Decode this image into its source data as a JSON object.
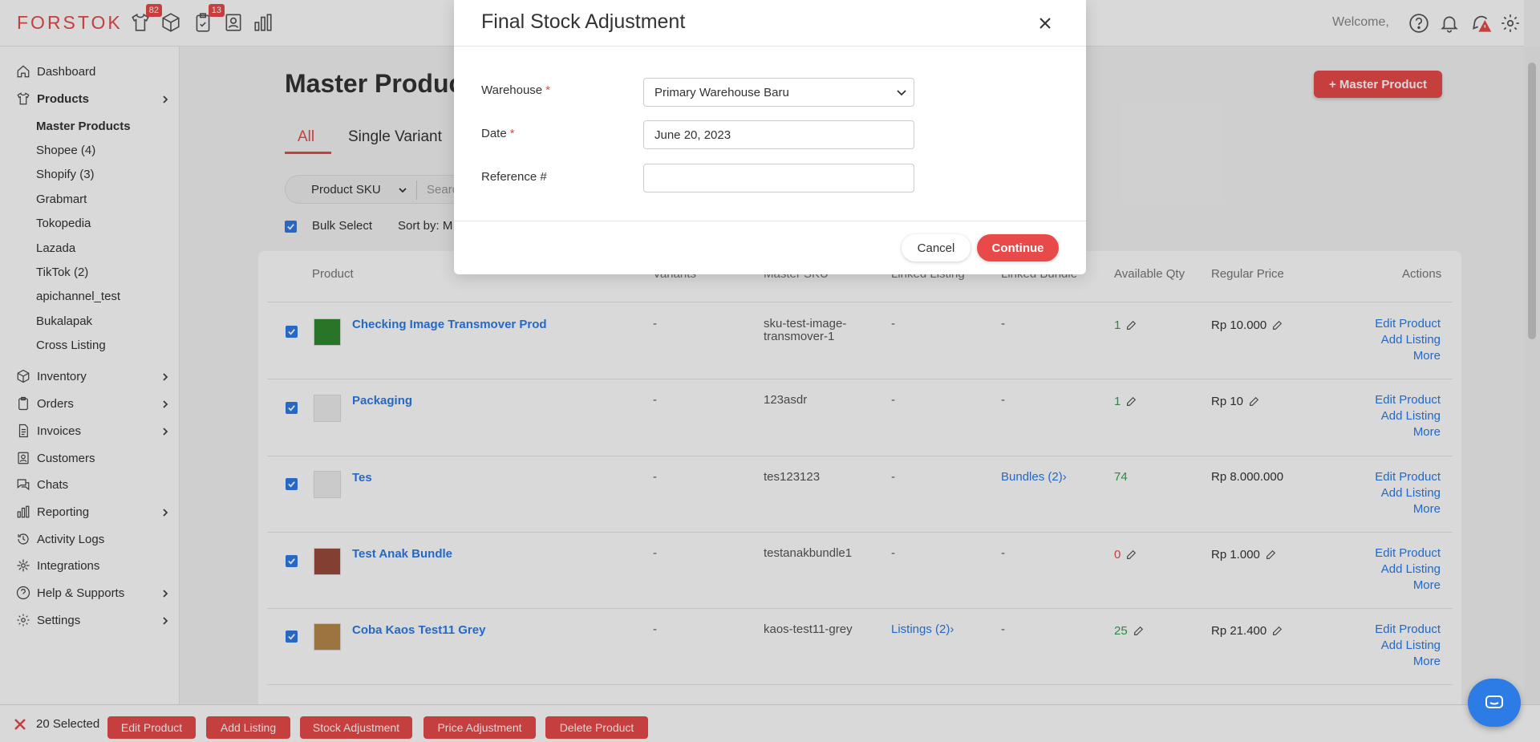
{
  "app": {
    "logo": "FORSTOK",
    "welcome": "Welcome,",
    "badges": {
      "products": "82",
      "orders": "13"
    }
  },
  "sidebar": {
    "items": [
      {
        "label": "Dashboard",
        "icon": "home-icon"
      },
      {
        "label": "Products",
        "icon": "shirt-icon"
      },
      {
        "label": "Inventory",
        "icon": "box-icon"
      },
      {
        "label": "Orders",
        "icon": "clipboard-icon"
      },
      {
        "label": "Invoices",
        "icon": "invoice-icon"
      },
      {
        "label": "Customers",
        "icon": "customers-icon"
      },
      {
        "label": "Chats",
        "icon": "chat-icon"
      },
      {
        "label": "Reporting",
        "icon": "chart-icon"
      },
      {
        "label": "Activity Logs",
        "icon": "history-icon"
      },
      {
        "label": "Integrations",
        "icon": "integrations-icon"
      },
      {
        "label": "Help & Supports",
        "icon": "help-icon"
      },
      {
        "label": "Settings",
        "icon": "gear-icon"
      }
    ],
    "sub_items": [
      "Master Products",
      "Shopee (4)",
      "Shopify (3)",
      "Grabmart",
      "Tokopedia",
      "Lazada",
      "TikTok (2)",
      "apichannel_test",
      "Bukalapak",
      "Cross Listing"
    ]
  },
  "main": {
    "title": "Master Product",
    "add_button": "+ Master Product",
    "tabs": [
      "All",
      "Single Variant"
    ],
    "filter": {
      "select": "Product SKU",
      "search_placeholder": "Searc"
    },
    "bulk_select": "Bulk Select",
    "sort_by": "Sort by:  M",
    "columns": [
      "Product",
      "Variants",
      "Master SKU",
      "Linked Listing",
      "Linked Bundle",
      "Available Qty",
      "Regular Price",
      "Actions"
    ],
    "rows": [
      {
        "name": "Checking Image Transmover Prod",
        "variants": "-",
        "sku": "sku-test-image-transmover-1",
        "listing": "-",
        "bundle": "-",
        "qty": "1",
        "price": "Rp 10.000"
      },
      {
        "name": "Packaging",
        "variants": "-",
        "sku": "123asdr",
        "listing": "-",
        "bundle": "-",
        "qty": "1",
        "price": "Rp 10"
      },
      {
        "name": "Tes",
        "variants": "-",
        "sku": "tes123123",
        "listing": "-",
        "bundle": "Bundles (2)",
        "qty": "74",
        "price": "Rp 8.000.000"
      },
      {
        "name": "Test Anak Bundle",
        "variants": "-",
        "sku": "testanakbundle1",
        "listing": "-",
        "bundle": "-",
        "qty": "0",
        "price": "Rp 1.000"
      },
      {
        "name": "Coba Kaos Test11 Grey",
        "variants": "-",
        "sku": "kaos-test11-grey",
        "listing": "Listings (2)",
        "bundle": "-",
        "qty": "25",
        "price": "Rp 21.400"
      }
    ],
    "actions": [
      "Edit Product",
      "Add Listing",
      "More"
    ]
  },
  "bottom_bar": {
    "selected": "20 Selected",
    "buttons": [
      "Edit Product",
      "Add Listing",
      "Stock Adjustment",
      "Price Adjustment",
      "Delete Product"
    ]
  },
  "modal": {
    "title": "Final Stock Adjustment",
    "warehouse_label": "Warehouse",
    "warehouse_value": "Primary Warehouse Baru",
    "date_label": "Date",
    "date_value": "June 20, 2023",
    "reference_label": "Reference #",
    "reference_value": "",
    "required_mark": "*",
    "cancel": "Cancel",
    "continue": "Continue"
  },
  "colors": {
    "accent": "#e84a4a",
    "link": "#2d7be5",
    "positive": "#2ea44f"
  }
}
